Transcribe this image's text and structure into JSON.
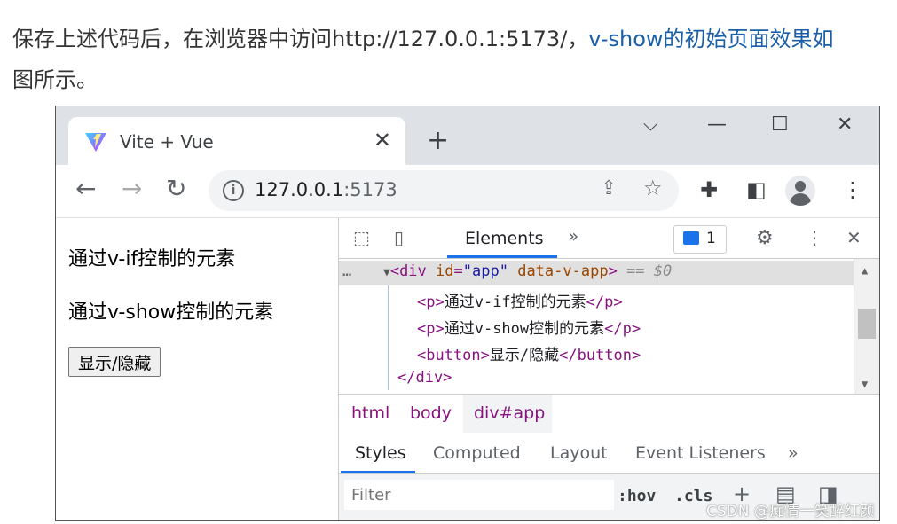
{
  "article": {
    "line1_prefix": "保存上述代码后，在浏览器中访问http://127.0.0.1:5173/，",
    "line1_link": "v-show的初始页面效果如",
    "line2": "图所示。"
  },
  "browser": {
    "tab": {
      "title": "Vite + Vue",
      "close": "✕"
    },
    "new_tab": "+",
    "window_controls": {
      "dropdown": "⌵",
      "minimize": "—",
      "maximize": "☐",
      "close": "✕"
    },
    "nav": {
      "back": "←",
      "forward": "→",
      "reload": "↻"
    },
    "omnibox": {
      "host": "127.0.0.1",
      "port": ":5173"
    },
    "icons": [
      "share-icon",
      "star-icon",
      "extensions-icon",
      "side-panel-icon",
      "profile-icon",
      "menu-icon"
    ]
  },
  "page": {
    "p1": "通过v-if控制的元素",
    "p2": "通过v-show控制的元素",
    "button": "显示/隐藏"
  },
  "devtools": {
    "main_tab": "Elements",
    "more_tabs": "»",
    "issues_count": "1",
    "dom": {
      "ellipsis": "…",
      "arrow": "▼",
      "div_open": "<div",
      "id_attr": "id",
      "id_val": "\"app\"",
      "data_attr": "data-v-app",
      "div_close_bracket": ">",
      "eq": "== $0",
      "p1_open": "<p>",
      "p1_text": "通过v-if控制的元素",
      "p1_close": "</p>",
      "p2_open": "<p>",
      "p2_text": "通过v-show控制的元素",
      "p2_close": "</p>",
      "btn_open": "<button>",
      "btn_text": "显示/隐藏",
      "btn_close": "</button>",
      "div_end": "</div>"
    },
    "breadcrumbs": [
      "html",
      "body",
      "div#app"
    ],
    "style_tabs": [
      "Styles",
      "Computed",
      "Layout",
      "Event Listeners",
      "»"
    ],
    "filter_placeholder": "Filter",
    "hov": ":hov",
    "cls": ".cls",
    "plus": "+"
  },
  "watermark": "CSDN @痴情一笑醉红颜",
  "colors": {
    "accent": "#1a73e8",
    "tag": "#881280",
    "attr": "#994500",
    "value": "#1a1aa6",
    "link": "#1a5fa8"
  }
}
